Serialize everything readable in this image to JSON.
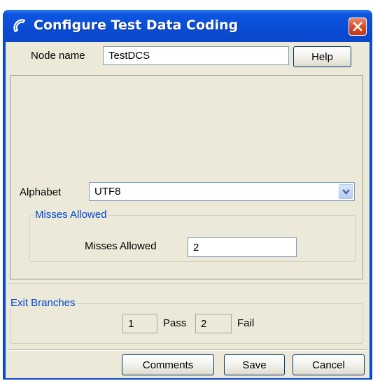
{
  "window": {
    "title": "Configure Test Data Coding",
    "title_icon": "phone-handset-icon",
    "close_icon": "close-icon"
  },
  "node": {
    "label": "Node name",
    "value": "TestDCS",
    "help_label": "Help"
  },
  "alphabet": {
    "label": "Alphabet",
    "value": "UTF8"
  },
  "misses_group": {
    "legend": "Misses Allowed",
    "label": "Misses Allowed",
    "value": "2"
  },
  "exit_branches": {
    "legend": "Exit Branches",
    "branches": [
      {
        "number": "1",
        "label": "Pass"
      },
      {
        "number": "2",
        "label": "Fail"
      }
    ]
  },
  "buttons": {
    "comments": "Comments",
    "save": "Save",
    "cancel": "Cancel"
  },
  "colors": {
    "titlebar": "#0a4bd4",
    "close": "#d44a21",
    "dialog_bg": "#ece9d8",
    "legend_text": "#0046d5"
  }
}
